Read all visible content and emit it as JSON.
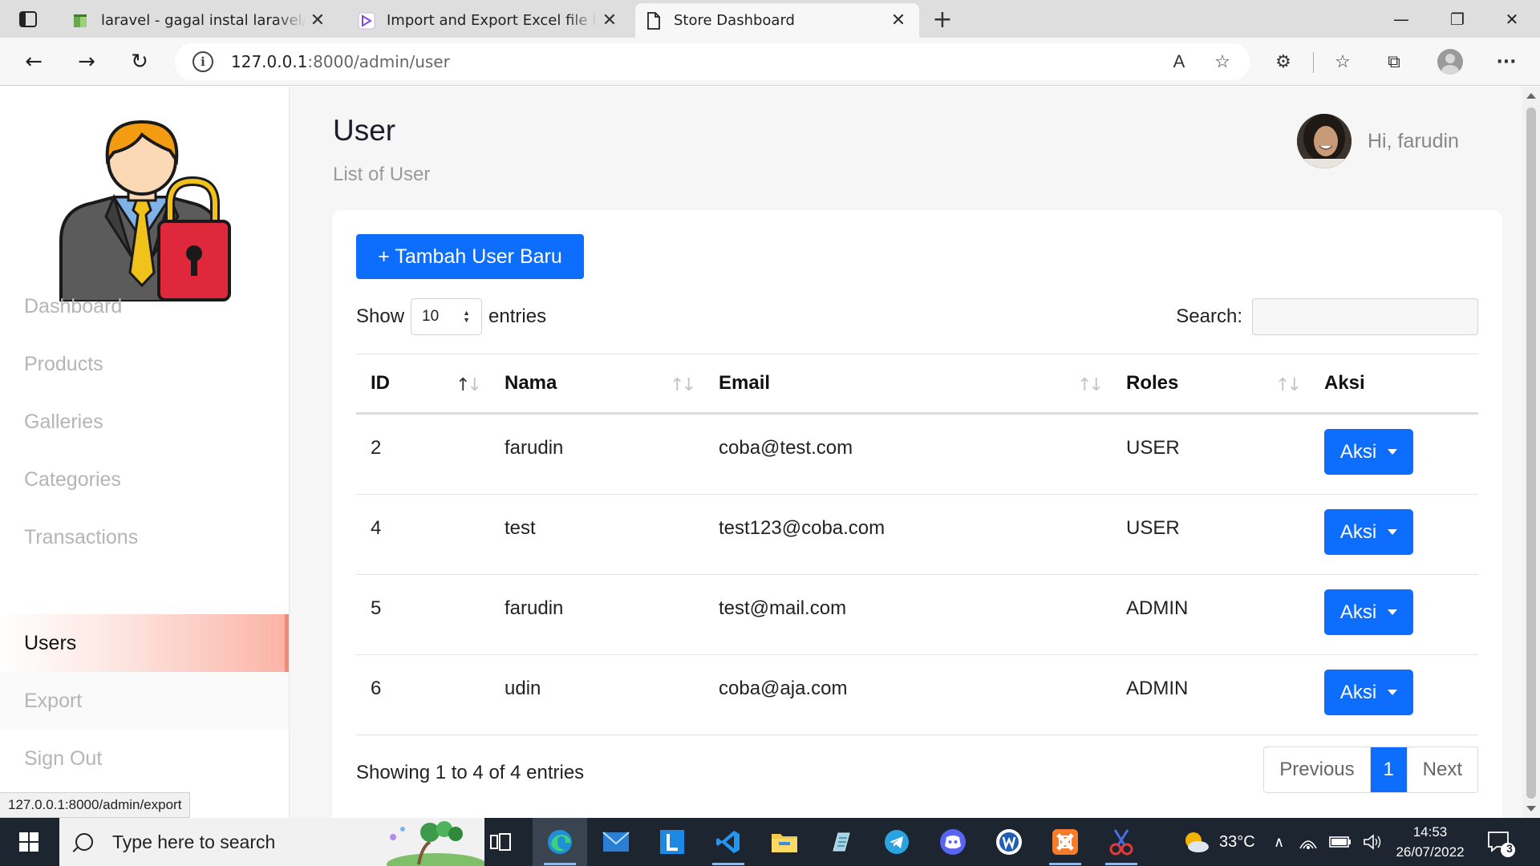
{
  "browser": {
    "tabs": [
      {
        "title": "laravel - gagal instal laravel/ui di",
        "active": false
      },
      {
        "title": "Import and Export Excel file in La",
        "active": false
      },
      {
        "title": "Store Dashboard",
        "active": true
      }
    ],
    "close_glyph": "✕",
    "new_tab_glyph": "+",
    "window_controls": {
      "minimize": "—",
      "maximize": "❐",
      "close": "✕"
    },
    "url_host": "127.0.0.1",
    "url_rest": ":8000/admin/user",
    "nav": {
      "back": "←",
      "forward": "→",
      "reload": "↻"
    },
    "toolbar_icons": {
      "read_aloud": "A",
      "favorite_add": "☆",
      "extensions": "⚙",
      "favorites": "☆",
      "collections": "⧉",
      "menu": "···"
    },
    "status_url": "127.0.0.1:8000/admin/export"
  },
  "sidebar": {
    "items": [
      {
        "label": "Dashboard"
      },
      {
        "label": "Products"
      },
      {
        "label": "Galleries"
      },
      {
        "label": "Categories"
      },
      {
        "label": "Transactions"
      },
      {
        "label": "Users",
        "active": true
      },
      {
        "label": "Export"
      },
      {
        "label": "Sign Out"
      }
    ]
  },
  "header": {
    "title": "User",
    "subtitle": "List of User",
    "greeting": "Hi, farudin"
  },
  "content": {
    "add_button": "+ Tambah User Baru",
    "length": {
      "show": "Show",
      "value": "10",
      "entries": "entries"
    },
    "search_label": "Search:",
    "columns": [
      "ID",
      "Nama",
      "Email",
      "Roles",
      "Aksi"
    ],
    "rows": [
      {
        "id": "2",
        "nama": "farudin",
        "email": "coba@test.com",
        "roles": "USER",
        "aksi": "Aksi"
      },
      {
        "id": "4",
        "nama": "test",
        "email": "test123@coba.com",
        "roles": "USER",
        "aksi": "Aksi"
      },
      {
        "id": "5",
        "nama": "farudin",
        "email": "test@mail.com",
        "roles": "ADMIN",
        "aksi": "Aksi"
      },
      {
        "id": "6",
        "nama": "udin",
        "email": "coba@aja.com",
        "roles": "ADMIN",
        "aksi": "Aksi"
      }
    ],
    "info": "Showing 1 to 4 of 4 entries",
    "pagination": {
      "previous": "Previous",
      "current": "1",
      "next": "Next"
    },
    "sort_glyphs": {
      "up": "↑",
      "down": "↓"
    }
  },
  "taskbar": {
    "search_placeholder": "Type here to search",
    "weather": "33°C",
    "time": "14:53",
    "date": "26/07/2022",
    "notification_count": "3",
    "apps": [
      "task-view",
      "edge",
      "mail",
      "l-app",
      "vscode",
      "file-explorer",
      "notepad",
      "telegram",
      "discord",
      "word-app",
      "xampp",
      "snipping-tool"
    ]
  },
  "colors": {
    "primary": "#0d6efd",
    "active_menu_accent": "#f08a78",
    "taskbar": "#1c2530"
  }
}
